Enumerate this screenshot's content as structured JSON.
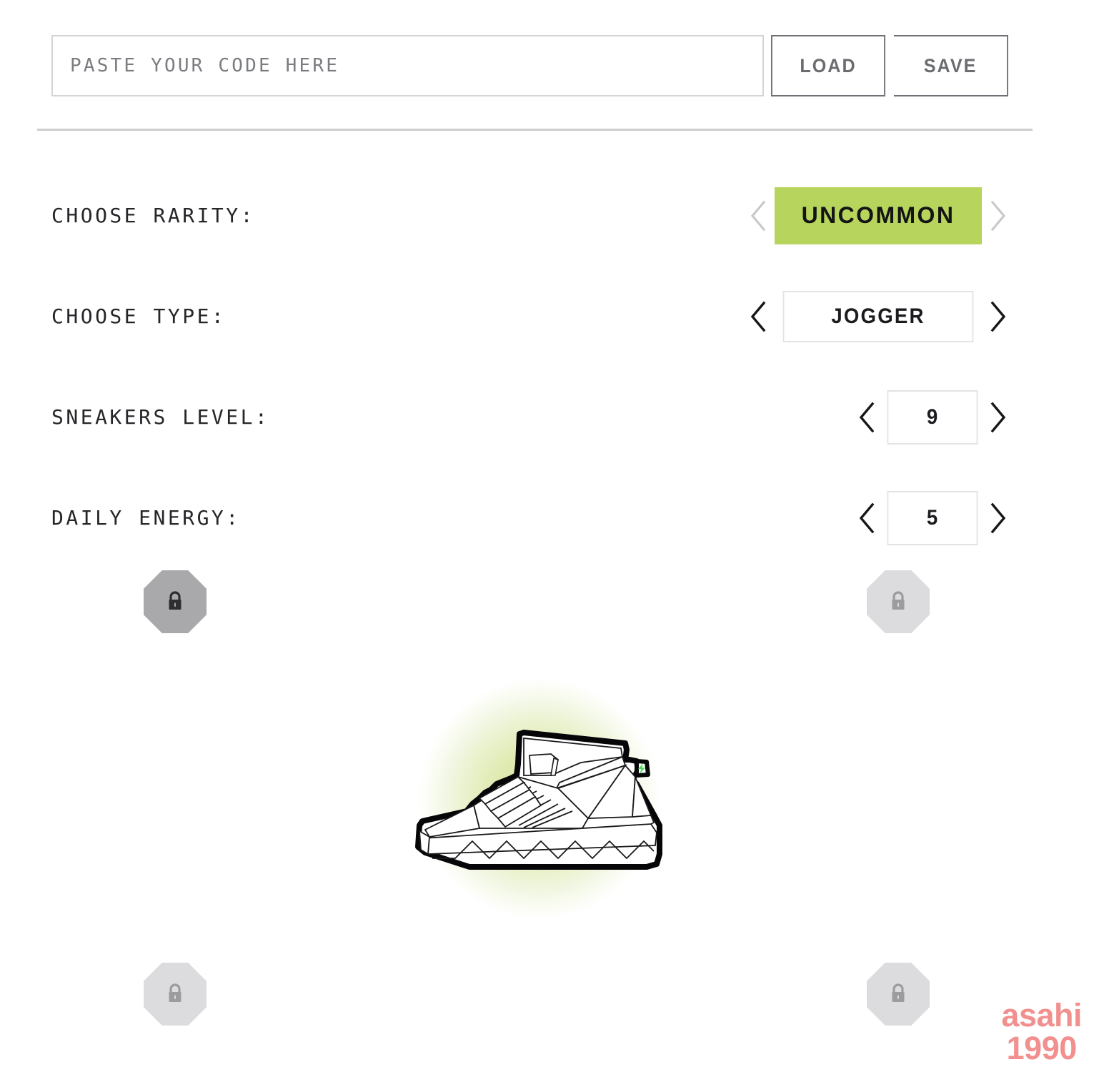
{
  "header": {
    "code_input_placeholder": "PASTE YOUR CODE HERE",
    "code_input_value": "",
    "load_label": "LOAD",
    "save_label": "SAVE"
  },
  "options": [
    {
      "label": "CHOOSE RARITY:",
      "value": "UNCOMMON",
      "style": "badge",
      "accent_color": "#b7d45c",
      "prev_enabled": false,
      "next_enabled": false
    },
    {
      "label": "CHOOSE TYPE:",
      "value": "JOGGER",
      "style": "wide",
      "prev_enabled": true,
      "next_enabled": true
    },
    {
      "label": "SNEAKERS LEVEL:",
      "value": "9",
      "style": "narrow",
      "prev_enabled": true,
      "next_enabled": true
    },
    {
      "label": "DAILY ENERGY:",
      "value": "5",
      "style": "narrow",
      "prev_enabled": true,
      "next_enabled": true
    }
  ],
  "locks": [
    {
      "position": "top-left",
      "state": "dark",
      "icon": "lock-icon"
    },
    {
      "position": "top-right",
      "state": "light",
      "icon": "lock-icon"
    },
    {
      "position": "bottom-left",
      "state": "light",
      "icon": "lock-icon"
    },
    {
      "position": "bottom-right",
      "state": "light",
      "icon": "lock-icon"
    }
  ],
  "preview": {
    "item": "sneaker-jogger-white",
    "glow_color": "#dbe9a8",
    "outline_color": "#000000",
    "body_color": "#ffffff",
    "accent_bolt_color": "#4ade5a"
  },
  "brand": {
    "line1": "asahi",
    "line2": "1990",
    "color": "#f2908f"
  },
  "icons": {
    "chevron_left": "chevron-left-icon",
    "chevron_right": "chevron-right-icon",
    "lock": "lock-icon"
  }
}
